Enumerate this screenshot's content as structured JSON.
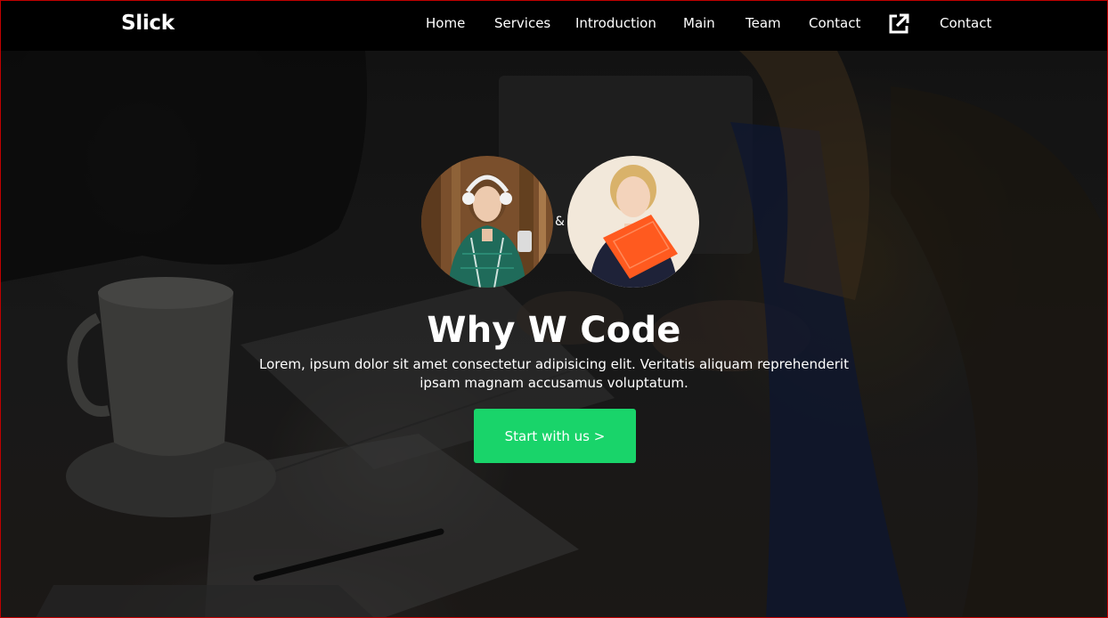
{
  "nav": {
    "brand": "Slick",
    "links": [
      "Home",
      "Services",
      "Introduction",
      "Main",
      "Team",
      "Contact"
    ],
    "external_icon": "external-link-icon",
    "contact_label": "Contact"
  },
  "hero": {
    "ampersand": "&",
    "title": "Why W Code",
    "text_line1": "Lorem, ipsum dolor sit amet consectetur adipisicing elit. Veritatis aliquam reprehenderit",
    "text_line2": "ipsam magnam accusamus voluptatum.",
    "cta_label": "Start with us >"
  },
  "colors": {
    "navbar_bg": "#000000",
    "cta_bg": "#19d46a",
    "frame_border": "#c00000"
  }
}
